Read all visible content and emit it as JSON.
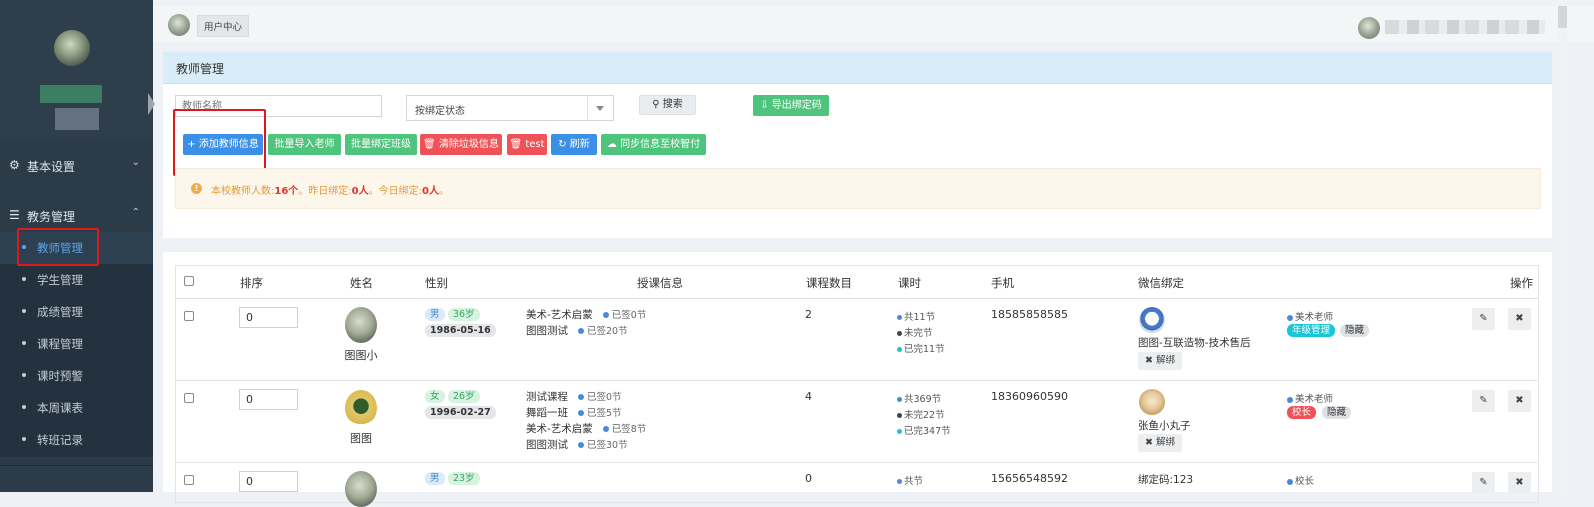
{
  "sidebar": {
    "groups": [
      {
        "icon": "gear-icon",
        "label": "基本设置"
      },
      {
        "icon": "database-icon",
        "label": "教务管理"
      }
    ],
    "items": [
      {
        "label": "教师管理",
        "active": true
      },
      {
        "label": "学生管理"
      },
      {
        "label": "成绩管理"
      },
      {
        "label": "课程管理"
      },
      {
        "label": "课时预警"
      },
      {
        "label": "本周课表"
      },
      {
        "label": "转班记录"
      }
    ]
  },
  "topbar": {
    "tab_label": "用户中心"
  },
  "panel": {
    "title": "教师管理",
    "search_placeholder": "教师名称",
    "bind_select_value": "按绑定状态",
    "search_button": "搜索",
    "export_button": "导出绑定码"
  },
  "actions": {
    "add": "添加教师信息",
    "import": "批量导入老师",
    "bind_class": "批量绑定班级",
    "clear": "清除垃圾信息",
    "test": "test",
    "refresh": "刷新",
    "sync": "同步信息至校智付"
  },
  "alert": {
    "p1": "本校教师人数:",
    "count": "16个",
    "p2": "。昨日绑定:",
    "yesterday": "0人",
    "p3": "。今日绑定:",
    "today": "0人",
    "p4": "。"
  },
  "table": {
    "headers": {
      "order": "排序",
      "name": "姓名",
      "gender": "性别",
      "courses": "授课信息",
      "course_count": "课程数目",
      "hours": "课时",
      "phone": "手机",
      "wechat": "微信绑定",
      "ops": "操作"
    },
    "rows": [
      {
        "order": "0",
        "name": "图图小",
        "gender": "男",
        "age": "36岁",
        "birthday": "1986-05-16",
        "courses": [
          {
            "name": "美术-艺术启蒙",
            "done": "已签0节"
          },
          {
            "name": "图图测试",
            "done": "已签20节"
          }
        ],
        "course_count": "2",
        "hours": {
          "total": "共11节",
          "undone": "未完节",
          "done": "已完11节"
        },
        "phone": "18585858585",
        "wechat": {
          "name": "图图-互联造物-技术售后",
          "unbind": "解绑"
        },
        "role": "美术老师",
        "badges": [
          "年级管理",
          "隐藏"
        ]
      },
      {
        "order": "0",
        "name": "图图",
        "gender": "女",
        "age": "26岁",
        "birthday": "1996-02-27",
        "courses": [
          {
            "name": "测试课程",
            "done": "已签0节"
          },
          {
            "name": "舞蹈一班",
            "done": "已签5节"
          },
          {
            "name": "美术-艺术启蒙",
            "done": "已签8节"
          },
          {
            "name": "图图测试",
            "done": "已签30节"
          }
        ],
        "course_count": "4",
        "hours": {
          "total": "共369节",
          "undone": "未完22节",
          "done": "已完347节"
        },
        "phone": "18360960590",
        "wechat": {
          "name": "张鱼小丸子",
          "unbind": "解绑"
        },
        "role": "美术老师",
        "badges": [
          "校长",
          "隐藏"
        ]
      },
      {
        "order": "0",
        "gender": "男",
        "age": "23岁",
        "course_count": "0",
        "hours": {
          "total": "共节"
        },
        "phone": "15656548592",
        "wechat": {
          "code": "绑定码:123"
        },
        "role": "校长"
      }
    ]
  },
  "colors": {
    "sidebar_bg": "#2c3b48",
    "active": "#5aa5ee",
    "primary": "#3b8fe6",
    "success": "#4fc47c",
    "danger": "#ef5357",
    "highlight": "#e0181c"
  }
}
